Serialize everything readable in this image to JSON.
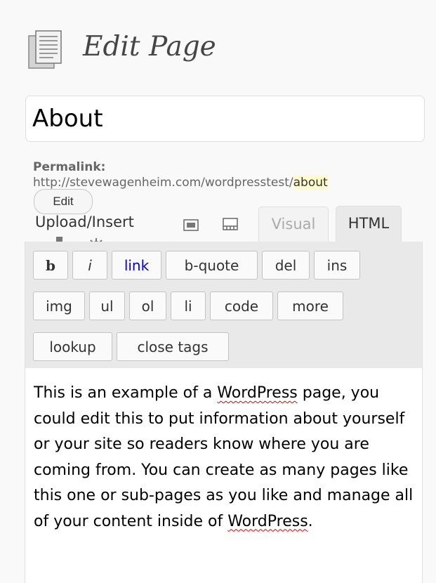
{
  "header": {
    "title": "Edit Page",
    "icon": "page-icon"
  },
  "title_field": {
    "value": "About"
  },
  "permalink": {
    "label": "Permalink:",
    "base_url": "http://stevewagenheim.com/wordpresstest/",
    "slug": "about",
    "edit_label": "Edit"
  },
  "media": {
    "label": "Upload/Insert",
    "icons": [
      "image-icon",
      "video-icon",
      "audio-icon",
      "media-icon"
    ]
  },
  "tabs": {
    "visual": "Visual",
    "html": "HTML",
    "active": "HTML"
  },
  "quicktags": {
    "b": "b",
    "i": "i",
    "link": "link",
    "bquote": "b-quote",
    "del": "del",
    "ins": "ins",
    "img": "img",
    "ul": "ul",
    "ol": "ol",
    "li": "li",
    "code": "code",
    "more": "more",
    "lookup": "lookup",
    "close": "close tags"
  },
  "content": {
    "part1": "This is an example of a ",
    "spell1": "WordPress",
    "part2": " page, you could edit this to put information about yourself or your site so readers know where you are coming from. You can create as many pages like this one or sub-pages as you like and manage all of your content inside of ",
    "spell2": "WordPress",
    "part3": "."
  },
  "colors": {
    "toolbar_bg": "#e9e9e9",
    "link_color": "#0000ee",
    "slug_highlight": "#fffbcc",
    "spellcheck": "#dd0000"
  }
}
